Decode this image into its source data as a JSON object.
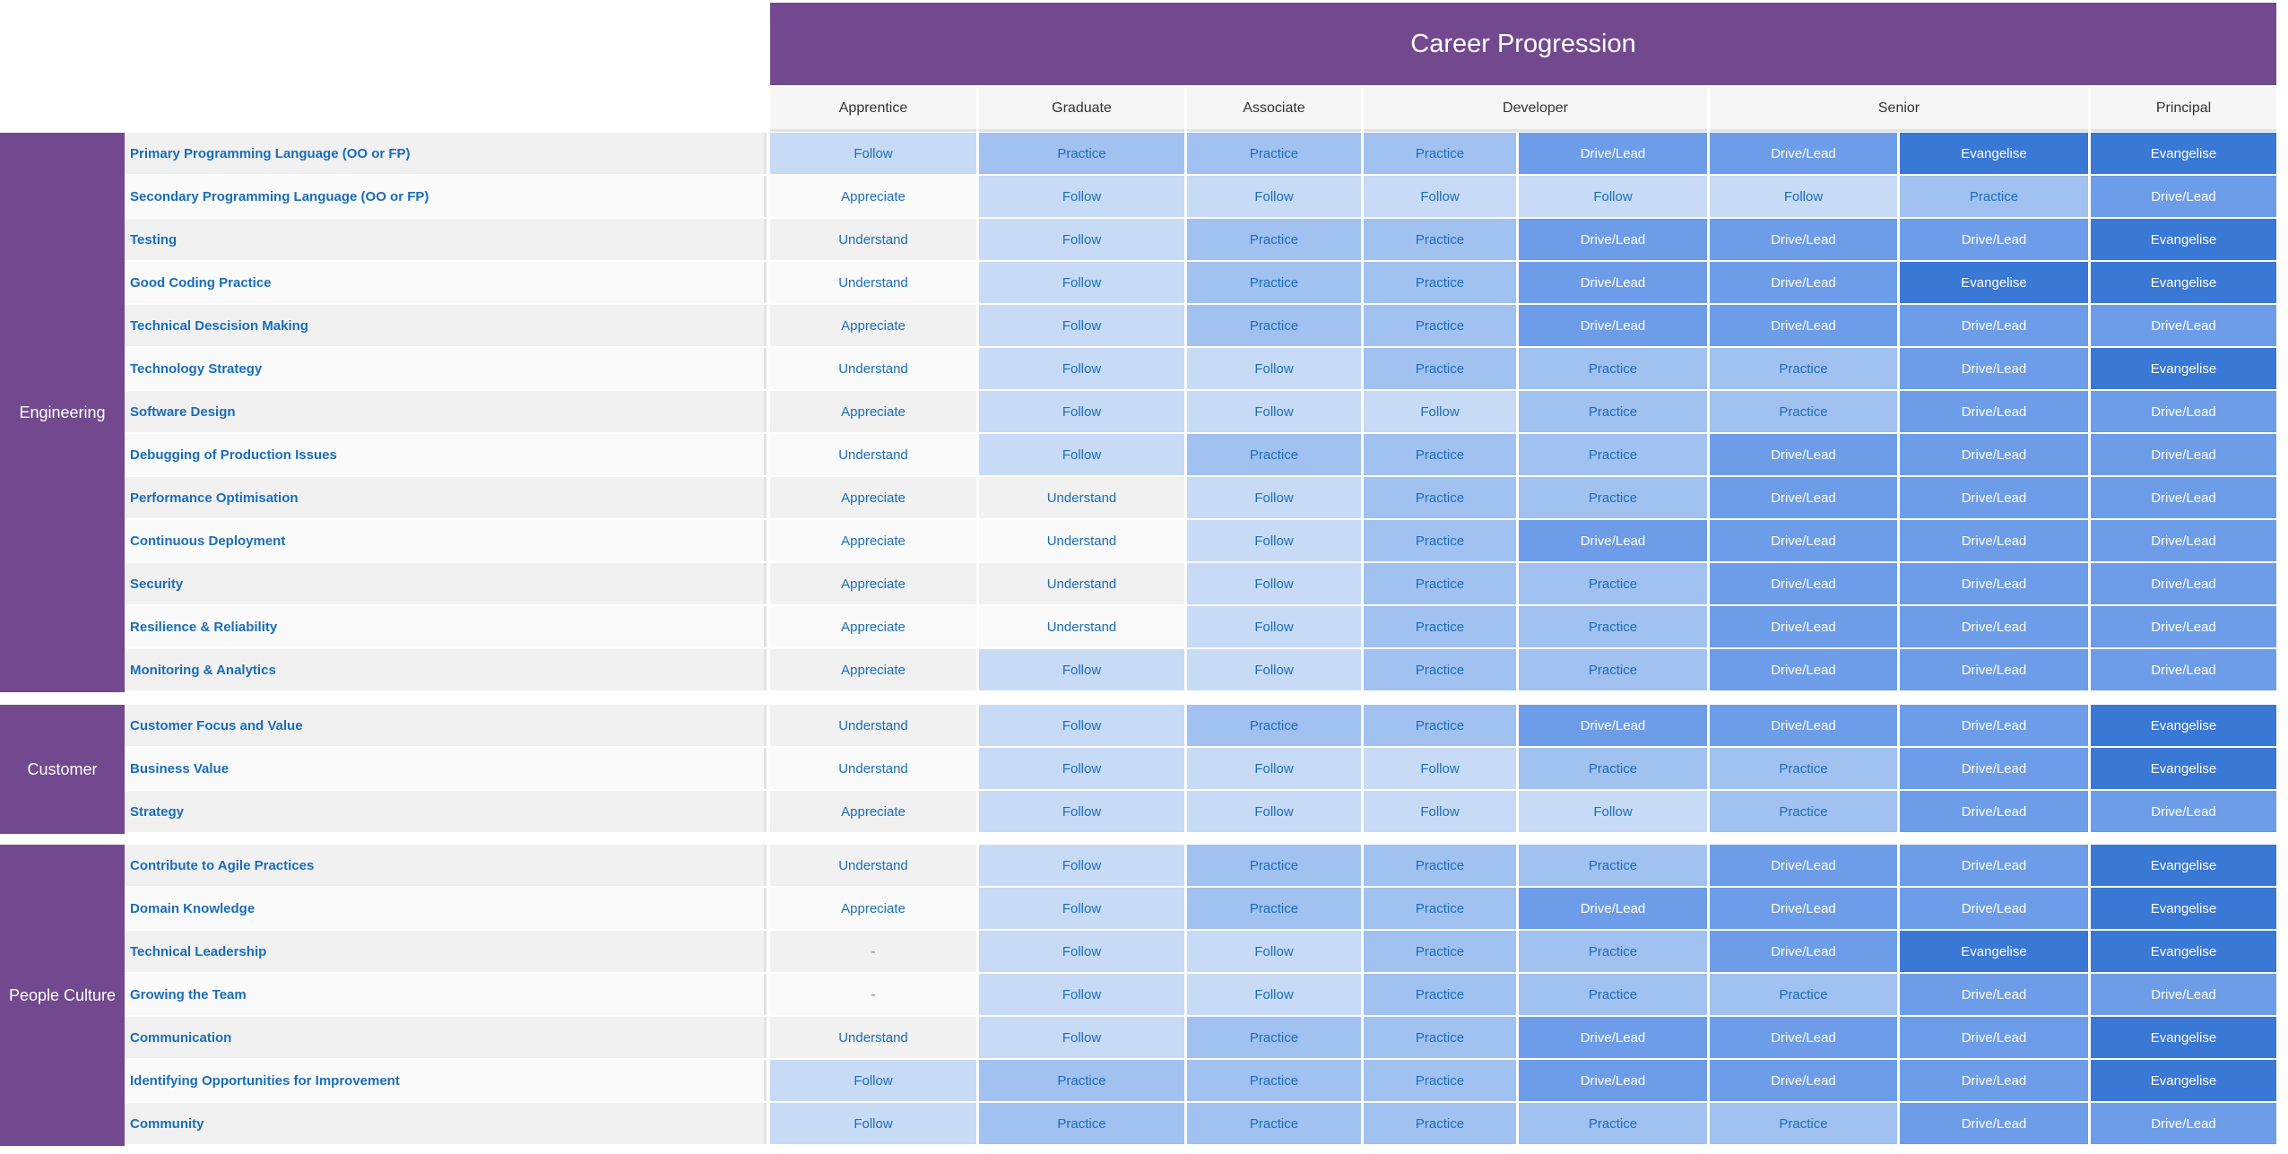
{
  "title": "Career Progression",
  "levels": [
    "Apprentice",
    "Graduate",
    "Associate",
    "Developer",
    "Senior",
    "Principal"
  ],
  "shade_colors": {
    "Follow": "#c7dbf6",
    "Practice": "#a1c1f0",
    "Drive/Lead": "#6d9de8",
    "Evangelise": "#3a78d6"
  },
  "text_colors": {
    "light": "#1a6db8",
    "dark": "#ffffff"
  },
  "groups": [
    {
      "name": "Engineering",
      "rows": [
        {
          "skill": "Primary Programming Language (OO or FP)",
          "values": [
            "Follow",
            "Practice",
            "Practice",
            "Practice",
            "Drive/Lead",
            "Drive/Lead",
            "Evangelise",
            "Evangelise"
          ]
        },
        {
          "skill": "Secondary Programming Language (OO or FP)",
          "values": [
            "Appreciate",
            "Follow",
            "Follow",
            "Follow",
            "Follow",
            "Follow",
            "Practice",
            "Drive/Lead"
          ]
        },
        {
          "skill": "Testing",
          "values": [
            "Understand",
            "Follow",
            "Practice",
            "Practice",
            "Drive/Lead",
            "Drive/Lead",
            "Drive/Lead",
            "Evangelise"
          ]
        },
        {
          "skill": "Good Coding Practice",
          "values": [
            "Understand",
            "Follow",
            "Practice",
            "Practice",
            "Drive/Lead",
            "Drive/Lead",
            "Evangelise",
            "Evangelise"
          ]
        },
        {
          "skill": "Technical Descision Making",
          "values": [
            "Appreciate",
            "Follow",
            "Practice",
            "Practice",
            "Drive/Lead",
            "Drive/Lead",
            "Drive/Lead",
            "Drive/Lead"
          ]
        },
        {
          "skill": "Technology Strategy",
          "values": [
            "Understand",
            "Follow",
            "Follow",
            "Practice",
            "Practice",
            "Practice",
            "Drive/Lead",
            "Evangelise"
          ]
        },
        {
          "skill": "Software Design",
          "values": [
            "Appreciate",
            "Follow",
            "Follow",
            "Follow",
            "Practice",
            "Practice",
            "Drive/Lead",
            "Drive/Lead"
          ]
        },
        {
          "skill": "Debugging of Production Issues",
          "values": [
            "Understand",
            "Follow",
            "Practice",
            "Practice",
            "Practice",
            "Drive/Lead",
            "Drive/Lead",
            "Drive/Lead"
          ]
        },
        {
          "skill": "Performance Optimisation",
          "values": [
            "Appreciate",
            "Understand",
            "Follow",
            "Practice",
            "Practice",
            "Drive/Lead",
            "Drive/Lead",
            "Drive/Lead"
          ]
        },
        {
          "skill": "Continuous Deployment",
          "values": [
            "Appreciate",
            "Understand",
            "Follow",
            "Practice",
            "Drive/Lead",
            "Drive/Lead",
            "Drive/Lead",
            "Drive/Lead"
          ]
        },
        {
          "skill": "Security",
          "values": [
            "Appreciate",
            "Understand",
            "Follow",
            "Practice",
            "Practice",
            "Drive/Lead",
            "Drive/Lead",
            "Drive/Lead"
          ]
        },
        {
          "skill": "Resilience & Reliability",
          "values": [
            "Appreciate",
            "Understand",
            "Follow",
            "Practice",
            "Practice",
            "Drive/Lead",
            "Drive/Lead",
            "Drive/Lead"
          ]
        },
        {
          "skill": "Monitoring & Analytics",
          "values": [
            "Appreciate",
            "Follow",
            "Follow",
            "Practice",
            "Practice",
            "Drive/Lead",
            "Drive/Lead",
            "Drive/Lead"
          ]
        }
      ]
    },
    {
      "name": "Customer",
      "rows": [
        {
          "skill": "Customer Focus and Value",
          "values": [
            "Understand",
            "Follow",
            "Practice",
            "Practice",
            "Drive/Lead",
            "Drive/Lead",
            "Drive/Lead",
            "Evangelise"
          ]
        },
        {
          "skill": "Business Value",
          "values": [
            "Understand",
            "Follow",
            "Follow",
            "Follow",
            "Practice",
            "Practice",
            "Drive/Lead",
            "Evangelise"
          ]
        },
        {
          "skill": "Strategy",
          "values": [
            "Appreciate",
            "Follow",
            "Follow",
            "Follow",
            "Follow",
            "Practice",
            "Drive/Lead",
            "Drive/Lead"
          ]
        }
      ]
    },
    {
      "name": "People Culture",
      "rows": [
        {
          "skill": "Contribute to Agile Practices",
          "values": [
            "Understand",
            "Follow",
            "Practice",
            "Practice",
            "Practice",
            "Drive/Lead",
            "Drive/Lead",
            "Evangelise"
          ]
        },
        {
          "skill": "Domain Knowledge",
          "values": [
            "Appreciate",
            "Follow",
            "Practice",
            "Practice",
            "Drive/Lead",
            "Drive/Lead",
            "Drive/Lead",
            "Evangelise"
          ]
        },
        {
          "skill": "Technical Leadership",
          "values": [
            "-",
            "Follow",
            "Follow",
            "Practice",
            "Practice",
            "Drive/Lead",
            "Evangelise",
            "Evangelise"
          ]
        },
        {
          "skill": "Growing the Team",
          "values": [
            "-",
            "Follow",
            "Follow",
            "Practice",
            "Practice",
            "Practice",
            "Drive/Lead",
            "Drive/Lead"
          ]
        },
        {
          "skill": "Communication",
          "values": [
            "Understand",
            "Follow",
            "Practice",
            "Practice",
            "Drive/Lead",
            "Drive/Lead",
            "Drive/Lead",
            "Evangelise"
          ]
        },
        {
          "skill": "Identifying Opportunities for Improvement",
          "values": [
            "Follow",
            "Practice",
            "Practice",
            "Practice",
            "Drive/Lead",
            "Drive/Lead",
            "Drive/Lead",
            "Evangelise"
          ]
        },
        {
          "skill": "Community",
          "values": [
            "Follow",
            "Practice",
            "Practice",
            "Practice",
            "Practice",
            "Practice",
            "Drive/Lead",
            "Drive/Lead"
          ]
        }
      ]
    }
  ]
}
